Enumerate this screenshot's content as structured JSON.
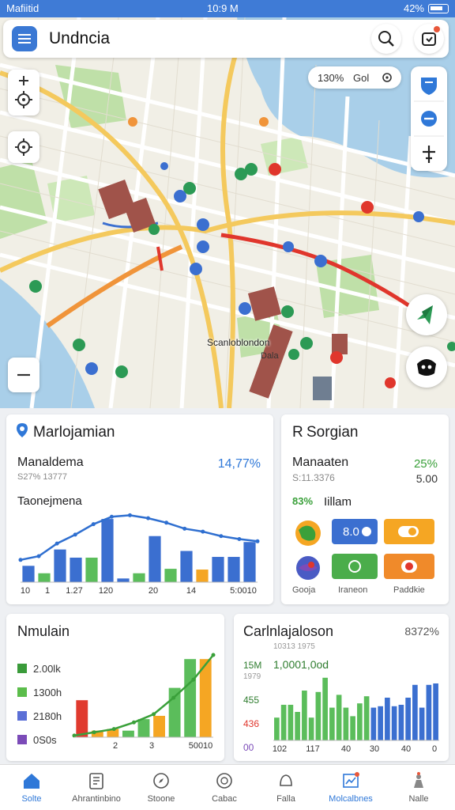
{
  "status_bar": {
    "carrier": "Mafiitid",
    "time": "10:9 M",
    "battery": "42%"
  },
  "app_bar": {
    "title": "Undncia"
  },
  "map": {
    "zoom_label": "130%",
    "zoom_mode": "Gol",
    "place_label": "Scanloblondon",
    "place_sublabel": "Dala"
  },
  "card_left": {
    "title": "Marlojamian",
    "metric_label": "Manaldema",
    "metric_sub": "S27% 13777",
    "metric_value": "14,77%",
    "chart_title": "Taonejmena",
    "x_labels": [
      "10",
      "1",
      "1.27",
      "120",
      "20",
      "14",
      "5:0010"
    ]
  },
  "card_right": {
    "title": "Sorgian",
    "prefix": "R",
    "metric_label": "Manaaten",
    "metric_sub": "S:11.3376",
    "metric_value": "25%",
    "metric_value2": "5.00",
    "legend_text": "Iillam",
    "legend_pct": "83%",
    "tiles": [
      "8.0",
      "",
      ""
    ],
    "labels": [
      "Gooja",
      "Iraneon",
      "Paddkie"
    ]
  },
  "card_bottom_left": {
    "title": "Nmulain",
    "legend": [
      {
        "value": "2.00lk",
        "color": "#3a9b3a"
      },
      {
        "value": "1300h",
        "color": "#5bbd4b"
      },
      {
        "value": "2180h",
        "color": "#5b6fd6"
      },
      {
        "value": "0S0s",
        "color": "#7b4bb8"
      }
    ],
    "x_labels": [
      "2",
      "3",
      "50010"
    ]
  },
  "card_bottom_right": {
    "title": "Carlnlajaloson",
    "pct": "8372%",
    "subtitle": "1,0001,0od",
    "sub_ref": "10313 1975",
    "left_labels": [
      "15M",
      "1979",
      "455",
      "436",
      "00"
    ],
    "x_labels": [
      "102",
      "117",
      "40",
      "30",
      "40",
      "0"
    ]
  },
  "nav": {
    "items": [
      {
        "label": "Solte",
        "icon": "home-icon",
        "active": true
      },
      {
        "label": "Ahrantinbino",
        "icon": "document-icon",
        "active": false
      },
      {
        "label": "Stoone",
        "icon": "compass-icon",
        "active": false
      },
      {
        "label": "Cabac",
        "icon": "wallet-icon",
        "active": false
      },
      {
        "label": "Falla",
        "icon": "bell-icon",
        "active": false
      },
      {
        "label": "Molcalbnes",
        "icon": "chart-icon",
        "active": true
      },
      {
        "label": "Nalle",
        "icon": "user-icon",
        "active": false
      }
    ]
  },
  "chart_data": [
    {
      "type": "bar",
      "title": "Taonejmena",
      "x_tick_labels": [
        "10",
        "1",
        "1.27",
        "120",
        "20",
        "14",
        "5:0010"
      ],
      "series": [
        {
          "values": [
            22,
            12,
            44,
            33,
            33,
            85,
            5,
            12,
            62,
            18,
            42,
            17,
            34,
            34,
            54
          ]
        }
      ],
      "line": [
        30,
        35,
        52,
        64,
        78,
        88,
        90,
        86,
        80,
        72,
        68,
        62,
        58,
        55
      ],
      "colors": [
        "#3b6fd0",
        "#5bbd5b",
        "#3b6fd0",
        "#3b6fd0",
        "#5bbd5b",
        "#3b6fd0",
        "#3b6fd0",
        "#5bbd5b",
        "#3b6fd0",
        "#5bbd5b",
        "#3b6fd0",
        "#f5a623",
        "#3b6fd0",
        "#3b6fd0",
        "#3b6fd0"
      ]
    },
    {
      "type": "bar",
      "title": "Nmulain",
      "x_tick_labels": [
        "2",
        "3",
        "50010"
      ],
      "series": [
        {
          "values": [
            45,
            8,
            10,
            8,
            22,
            26,
            60,
            95,
            95
          ]
        }
      ],
      "line": [
        2,
        6,
        10,
        18,
        28,
        48,
        70,
        100
      ],
      "colors": [
        "#e03a2e",
        "#f5a623",
        "#f5a623",
        "#5bbd5b",
        "#5bbd5b",
        "#f5a623",
        "#5bbd5b",
        "#5bbd5b",
        "#f5a623"
      ]
    },
    {
      "type": "bar",
      "title": "Carlnlajaloson",
      "x_tick_labels": [
        "102",
        "117",
        "40",
        "30",
        "40",
        "0"
      ],
      "series": [
        {
          "values": [
            32,
            50,
            50,
            40,
            70,
            32,
            68,
            88,
            46,
            64,
            46,
            34,
            52,
            62,
            46,
            48,
            60,
            48,
            50,
            60,
            78,
            46,
            78,
            80
          ]
        }
      ],
      "colors": [
        "#5bbd5b",
        "#5bbd5b",
        "#5bbd5b",
        "#5bbd5b",
        "#5bbd5b",
        "#5bbd5b",
        "#5bbd5b",
        "#5bbd5b",
        "#5bbd5b",
        "#5bbd5b",
        "#5bbd5b",
        "#5bbd5b",
        "#5bbd5b",
        "#5bbd5b",
        "#3b6fd0",
        "#3b6fd0",
        "#3b6fd0",
        "#3b6fd0",
        "#3b6fd0",
        "#3b6fd0",
        "#3b6fd0",
        "#3b6fd0",
        "#3b6fd0",
        "#3b6fd0"
      ]
    }
  ]
}
